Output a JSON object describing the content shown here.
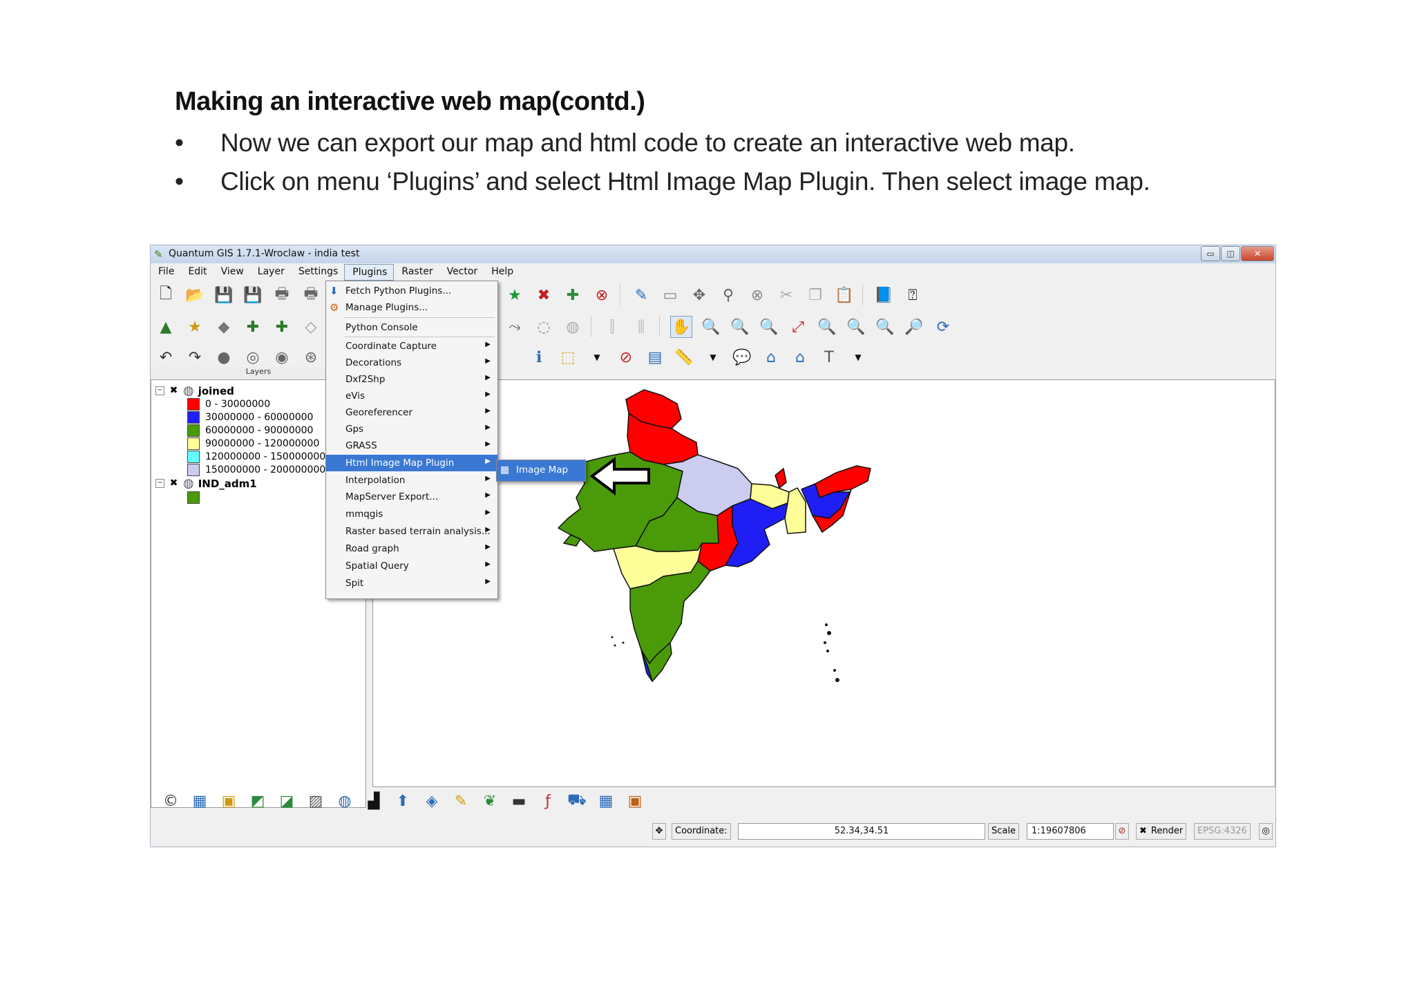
{
  "slide": {
    "title": "Making an interactive web map(contd.)",
    "bullets": [
      {
        "marker": "•",
        "text": "Now we can export our map and html code to create an interactive web map."
      },
      {
        "marker": "•",
        "text": "Click on menu ‘Plugins’ and select Html Image Map Plugin. Then select image map."
      }
    ]
  },
  "window": {
    "title": "Quantum GIS 1.7.1-Wroclaw - india test",
    "controls": {
      "minimize": "▭",
      "maximize": "◫",
      "close": "✕"
    }
  },
  "menubar": [
    "File",
    "Edit",
    "View",
    "Layer",
    "Settings",
    "Plugins",
    "Raster",
    "Vector",
    "Help"
  ],
  "plugins_menu": {
    "items": [
      {
        "label": "Fetch Python Plugins...",
        "icon": "fetch-plugins-icon",
        "submenu": false
      },
      {
        "label": "Manage Plugins...",
        "icon": "manage-plugins-icon",
        "submenu": false
      },
      {
        "label": "Python Console",
        "submenu": false
      },
      {
        "label": "Coordinate Capture",
        "submenu": true
      },
      {
        "label": "Decorations",
        "submenu": true
      },
      {
        "label": "Dxf2Shp",
        "submenu": true
      },
      {
        "label": "eVis",
        "submenu": true
      },
      {
        "label": "Georeferencer",
        "submenu": true
      },
      {
        "label": "Gps",
        "submenu": true
      },
      {
        "label": "GRASS",
        "submenu": true
      },
      {
        "label": "Html Image Map Plugin",
        "submenu": true,
        "highlighted": true
      },
      {
        "label": "Interpolation",
        "submenu": true
      },
      {
        "label": "MapServer Export...",
        "submenu": true
      },
      {
        "label": "mmqgis",
        "submenu": true
      },
      {
        "label": "Raster based terrain analysis...",
        "submenu": true
      },
      {
        "label": "Road graph",
        "submenu": true
      },
      {
        "label": "Spatial Query",
        "submenu": true
      },
      {
        "label": "Spit",
        "submenu": true
      }
    ],
    "submenu_item": "Image Map"
  },
  "layers_panel": {
    "title": "Layers",
    "layers": [
      {
        "name": "joined",
        "checked": "✖",
        "classes": [
          {
            "label": "0 - 30000000",
            "color": "#ff0000"
          },
          {
            "label": "30000000 - 60000000",
            "color": "#1f1ff5"
          },
          {
            "label": "60000000 - 90000000",
            "color": "#4a9a0a"
          },
          {
            "label": "90000000 - 120000000",
            "color": "#ffff99"
          },
          {
            "label": "120000000 - 150000000",
            "color": "#66ffff"
          },
          {
            "label": "150000000 - 200000000",
            "color": "#ccccf0"
          }
        ]
      },
      {
        "name": "IND_adm1",
        "checked": "✖",
        "classes": [
          {
            "label": "",
            "color": "#4a9a0a"
          }
        ]
      }
    ]
  },
  "statusbar": {
    "coordinate_label": "Coordinate:",
    "coordinate_value": "52.34,34.51",
    "scale_label": "Scale",
    "scale_value": "1:19607806",
    "render_label": "Render",
    "render_checked": "✖",
    "crs": "EPSG:4326"
  },
  "colors": {
    "red": "#ff0000",
    "blue": "#1f1ff5",
    "green": "#4a9a0a",
    "yellow": "#ffff99",
    "lavender": "#ccccf0",
    "highlight": "#3a78d4"
  }
}
